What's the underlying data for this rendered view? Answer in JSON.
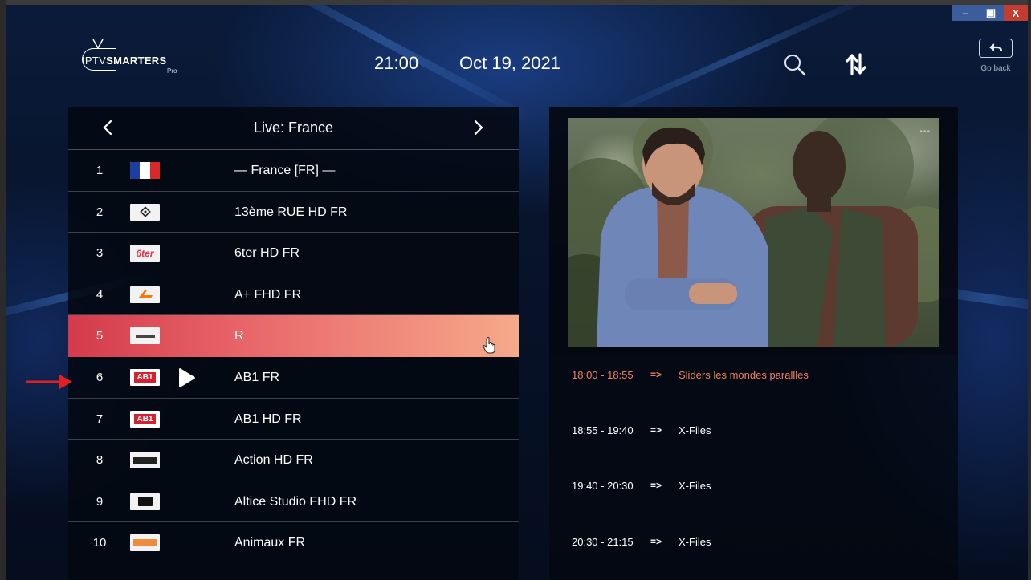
{
  "window": {
    "minimize_label": "–",
    "restore_label": "▣",
    "close_label": "X"
  },
  "header": {
    "logo": {
      "iptv": "IPTV",
      "smarters": "SMARTERS",
      "pro": "Pro"
    },
    "time": "21:00",
    "date": "Oct 19, 2021",
    "go_back_label": "Go back"
  },
  "channel_list": {
    "title": "Live: France",
    "channels": [
      {
        "number": "1",
        "name": "— France [FR] —",
        "logo": "france-flag"
      },
      {
        "number": "2",
        "name": "13ème RUE HD FR",
        "logo": "13eme-rue-logo"
      },
      {
        "number": "3",
        "name": "6ter HD FR",
        "logo": "6ter-logo",
        "logo_text": "6ter"
      },
      {
        "number": "4",
        "name": "A+ FHD FR",
        "logo": "aplus-logo"
      },
      {
        "number": "5",
        "name": "R",
        "logo": "generic-logo",
        "selected": true
      },
      {
        "number": "6",
        "name": "AB1 FR",
        "logo": "ab1-logo",
        "logo_text": "AB1",
        "playing": true
      },
      {
        "number": "7",
        "name": "AB1 HD FR",
        "logo": "ab1-logo",
        "logo_text": "AB1"
      },
      {
        "number": "8",
        "name": "Action HD FR",
        "logo": "action-logo"
      },
      {
        "number": "9",
        "name": "Altice Studio FHD FR",
        "logo": "altice-logo"
      },
      {
        "number": "10",
        "name": "Animaux FR",
        "logo": "animaux-logo"
      }
    ]
  },
  "epg": [
    {
      "time": "18:00 - 18:55",
      "arrow": "=>",
      "title": "Sliders les mondes parallles",
      "current": true
    },
    {
      "time": "18:55 - 19:40",
      "arrow": "=>",
      "title": "X-Files"
    },
    {
      "time": "19:40 - 20:30",
      "arrow": "=>",
      "title": "X-Files"
    },
    {
      "time": "20:30 - 21:15",
      "arrow": "=>",
      "title": "X-Files"
    }
  ],
  "colors": {
    "selected_start": "#d43a4b",
    "selected_end": "#f6a98a",
    "current_program": "#f08060",
    "close_button": "#c43b2f",
    "window_button": "#3b5d9c"
  }
}
